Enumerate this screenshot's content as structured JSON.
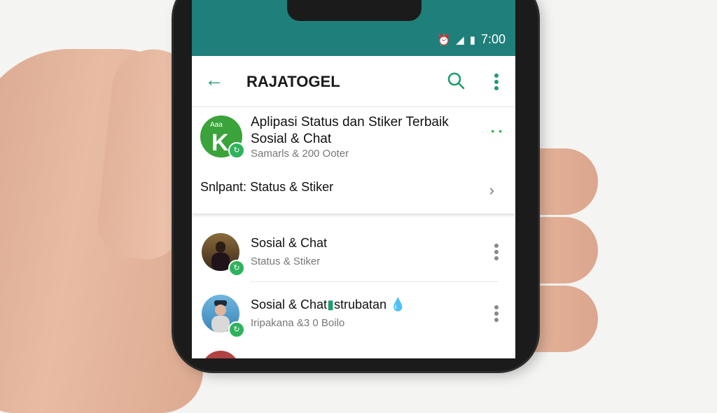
{
  "status_bar": {
    "time": "7:00",
    "icons": [
      "alarm-icon",
      "signal-icon",
      "battery-icon"
    ]
  },
  "app_bar": {
    "title": "RAJATOGEL",
    "icons": [
      "back-arrow-icon",
      "search-icon",
      "more-vert-icon"
    ]
  },
  "featured": {
    "title": "Aplipasi Status dan Stiker Terbaik Sosial & Chat",
    "subtitle": "Samarls  & 200 Ooter",
    "logo_text": "Aaa",
    "logo_letter": "K",
    "link_label": "Snlpant:",
    "link_value": "Status & Stiker"
  },
  "list": [
    {
      "name": "Sosial & Chat",
      "sub": "Status & Stiker",
      "emoji": ""
    },
    {
      "name": "Sosial & Chat",
      "badge_text": "strubatan",
      "emoji": "💧",
      "sub": "Iripakana &3 0 Boilo"
    }
  ],
  "colors": {
    "accent": "#1f7f7b",
    "green": "#2db35d"
  }
}
